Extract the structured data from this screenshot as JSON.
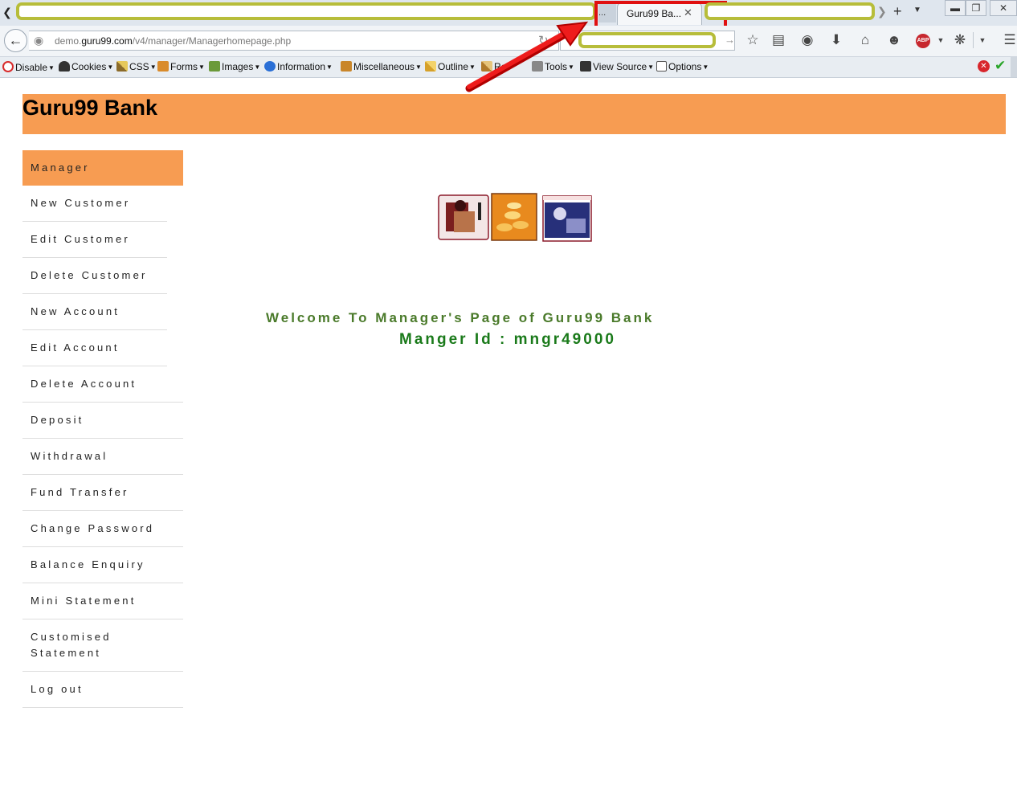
{
  "browser": {
    "prev_tab_label": "...",
    "active_tab_title": "Guru99 Ba...",
    "url_prefix": "demo.",
    "url_domain": "guru99.com",
    "url_path": "/v4/manager/Managerhomepage.php"
  },
  "webdev_toolbar": {
    "items": [
      "Disable",
      "Cookies",
      "CSS",
      "Forms",
      "Images",
      "Information",
      "Miscellaneous",
      "Outline",
      "Re",
      "Tools",
      "View Source",
      "Options"
    ]
  },
  "page": {
    "brand": "Guru99 Bank",
    "menu": [
      "Manager",
      "New Customer",
      "Edit Customer",
      "Delete Customer",
      "New Account",
      "Edit Account",
      "Delete Account",
      "Deposit",
      "Withdrawal",
      "Fund Transfer",
      "Change Password",
      "Balance Enquiry",
      "Mini Statement",
      "Customised Statement",
      "Log out"
    ],
    "welcome": "Welcome To Manager's Page of Guru99 Bank",
    "manager_id": "Manger Id : mngr49000"
  },
  "colors": {
    "header_orange": "#f79c52",
    "highlight_yellow": "#b7bd3a",
    "annotation_red": "#e01010",
    "welcome_green": "#4a7a2a"
  }
}
